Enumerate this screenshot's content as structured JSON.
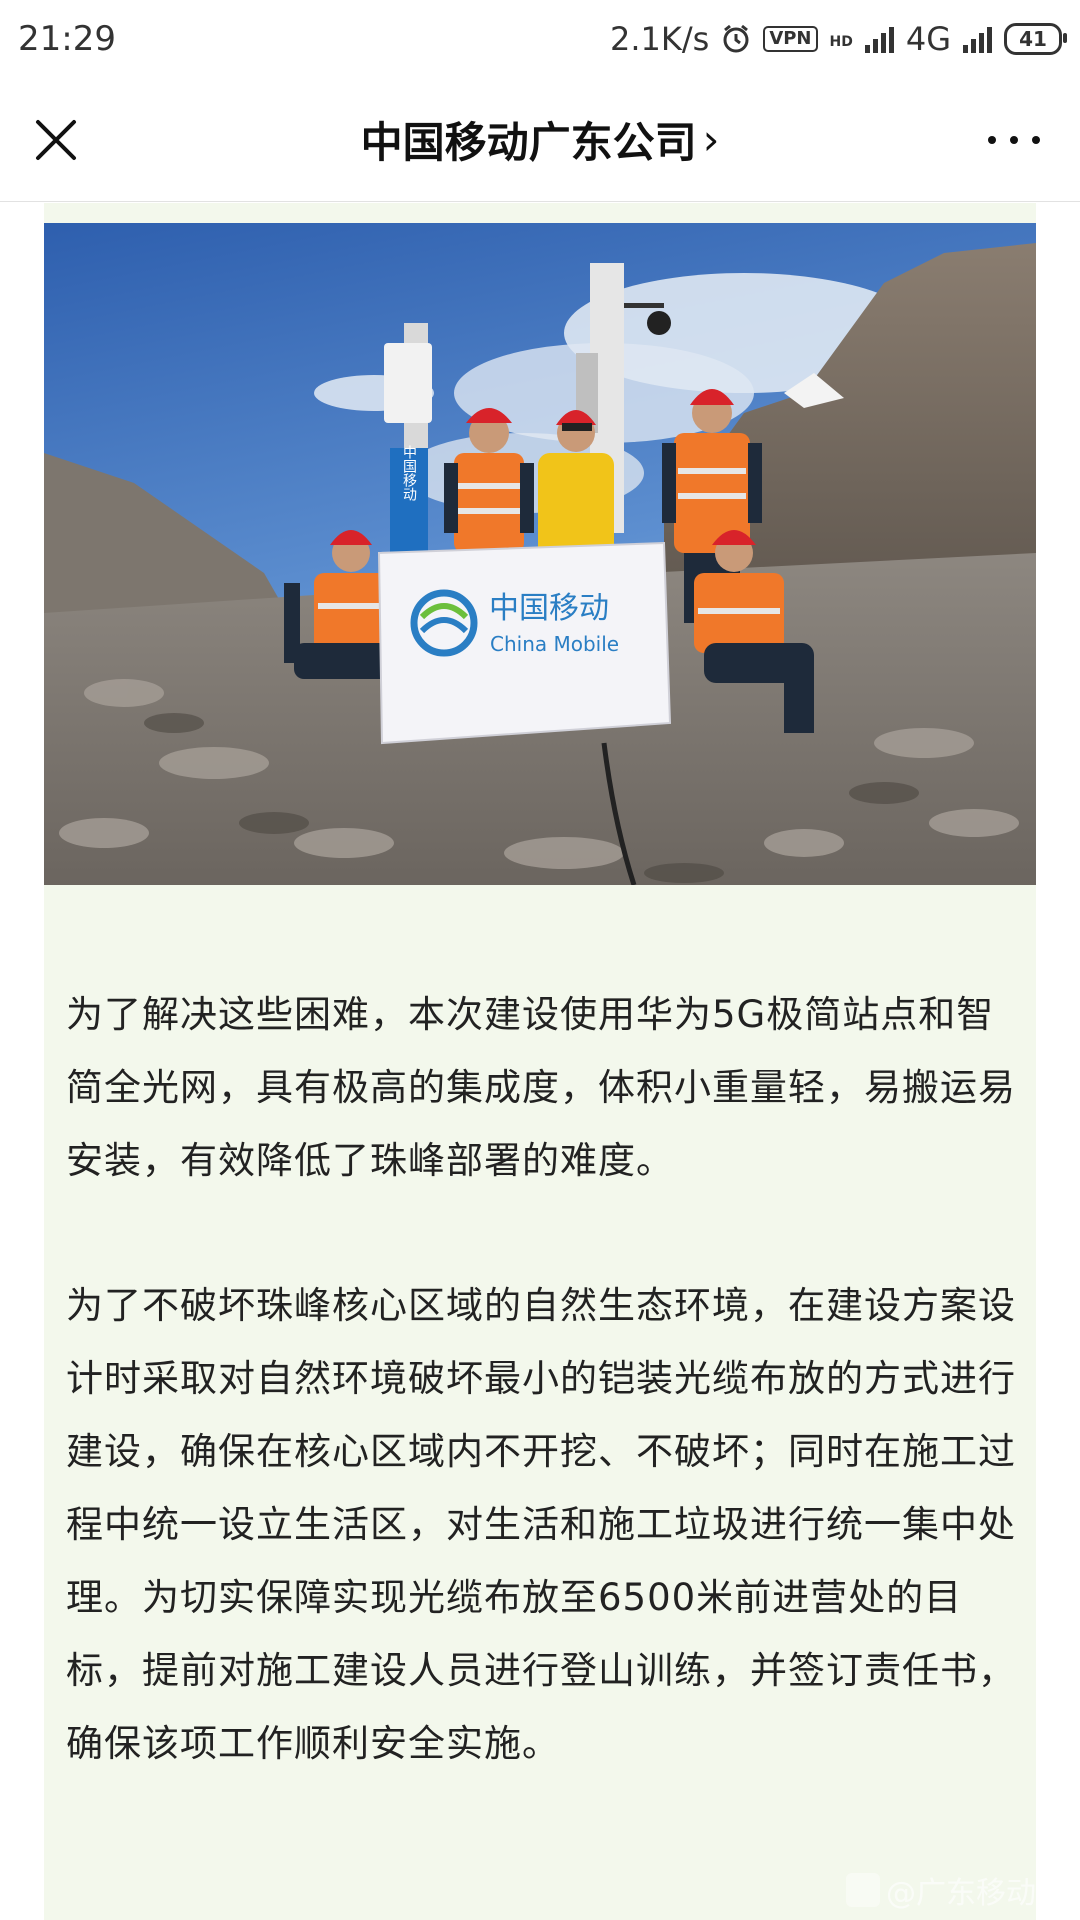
{
  "status_bar": {
    "time": "21:29",
    "speed": "2.1K/s",
    "vpn": "VPN",
    "network": "4G",
    "hd": "HD",
    "battery": "41",
    "icons": [
      "alarm-icon",
      "signal-icon",
      "battery-icon"
    ]
  },
  "nav": {
    "title": "中国移动广东公司",
    "chevron": "›",
    "close_icon": "close-icon",
    "more_icon": "more-icon"
  },
  "photo": {
    "banner_cn": "中国移动",
    "banner_en": "China Mobile",
    "pole_sign": "中国移动"
  },
  "paragraphs": [
    "为了解决这些困难，本次建设使用华为5G极简站点和智简全光网，具有极高的集成度，体积小重量轻，易搬运易安装，有效降低了珠峰部署的难度。",
    "为了不破坏珠峰核心区域的自然生态环境，在建设方案设计时采取对自然环境破坏最小的铠装光缆布放的方式进行建设，确保在核心区域内不开挖、不破坏；同时在施工过程中统一设立生活区，对生活和施工垃圾进行统一集中处理。为切实保障实现光缆布放至6500米前进营处的目标，提前对施工建设人员进行登山训练，并签订责任书，确保该项工作顺利安全实施。"
  ],
  "watermark": "@广东移动",
  "colors": {
    "article_bg": "#f3f8ec",
    "sky": "#3f6fb8",
    "vest_orange": "#f0782a",
    "helmet_red": "#d8232a",
    "brand_blue": "#2a7ec4"
  }
}
